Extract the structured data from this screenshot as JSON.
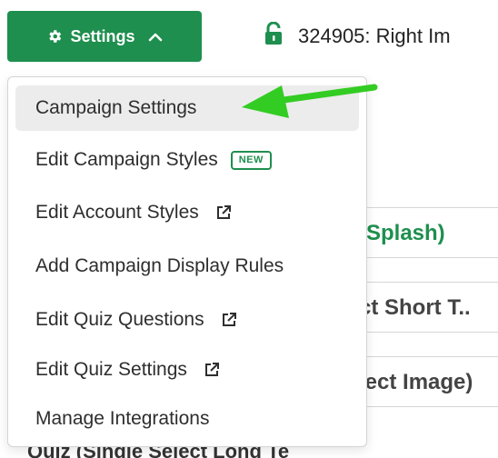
{
  "settings_button": {
    "label": "Settings"
  },
  "campaign_title": "324905: Right Im",
  "menu": {
    "items": [
      {
        "label": "Campaign Settings"
      },
      {
        "label": "Edit Campaign Styles",
        "badge": "NEW"
      },
      {
        "label": "Edit Account Styles"
      },
      {
        "label": "Add Campaign Display Rules"
      },
      {
        "label": "Edit Quiz Questions"
      },
      {
        "label": "Edit Quiz Settings"
      },
      {
        "label": "Manage Integrations"
      }
    ]
  },
  "background_cards": [
    {
      "text": "(Splash)"
    },
    {
      "text": "ct Short T.."
    },
    {
      "text": "lect Image)"
    }
  ],
  "bottom_partial_text": "Quiz (Single Select Long Te",
  "colors": {
    "brand_green": "#1e8f4e",
    "annotation_arrow": "#33cc22"
  },
  "icons": {
    "gear": "gear-icon",
    "chevron": "chevron-up-icon",
    "lock": "unlock-icon",
    "external": "external-link-icon"
  }
}
